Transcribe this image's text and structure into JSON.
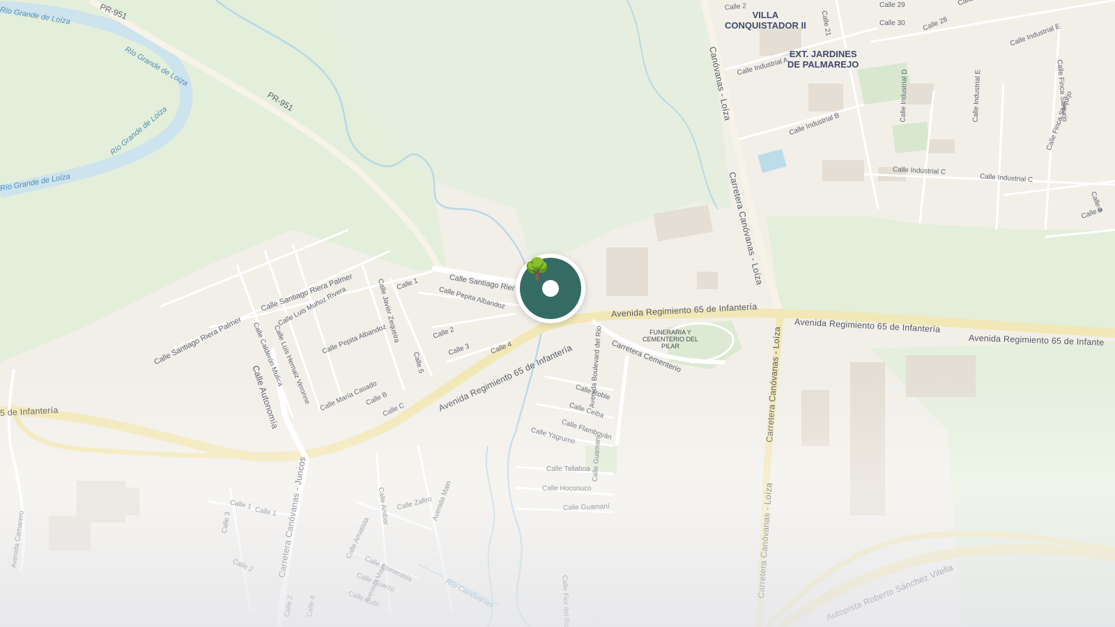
{
  "map": {
    "colors": {
      "land": "#f2efe9",
      "park": "#e3eedb",
      "water": "#cde3ee",
      "road": "#ffffff",
      "highway": "#f2e7b6",
      "building": "#e4ded4",
      "marker": "#356b65"
    },
    "marker": {
      "icon": "tree-icon",
      "color": "#356b65"
    },
    "labels": {
      "rio_grande_1": "Río Grande de Loíza",
      "rio_grande_2": "Río Grande de Loíza",
      "rio_grande_3": "Río Grande de Loíza",
      "rio_grande_4": "Río Grande de Loíza",
      "pr951_top": "PR-951",
      "pr951": "PR-951",
      "villa": "VILLA\nCONQUISTADOR II",
      "ext_jardines": "EXT. JARDINES\nDE PALMAREJO",
      "calle_2_top": "Calle 2",
      "calle_21": "Calle 21",
      "calle_29": "Calle 29",
      "calle_30": "Calle 30",
      "calle_28": "Calle 28",
      "calle_31": "Calle 31",
      "calle_industrial_e_1": "Calle Industrial E",
      "calle_industrial_a": "Calle Industrial A",
      "calle_industrial_b": "Calle Industrial B",
      "calle_industrial_c_1": "Calle Industrial C",
      "calle_industrial_c_2": "Calle Industrial C",
      "calle_industrial_d": "Calle Industrial D",
      "calle_industrial_e_2": "Calle Industrial E",
      "calle_finca": "Calle Finca Sanjurjo",
      "calle_finca_2": "Calle Finca Sanjurjo",
      "calle_9": "Calle 9",
      "calle_8": "Calle 8",
      "carretera_top": "Carretera Canóvanas - Loíza",
      "canovanas_loiza_top": "Canóvanas - Loíza",
      "avenida_1": "Avenida Regimiento 65 de Infantería",
      "avenida_2": "Avenida Regimiento 65 de Infantería",
      "avenida_3": "Avenida Regimiento 65 de Infante",
      "avenida_4": "Avenida Regimiento 65 de Infantería",
      "avenida_left": "5 de Infantería",
      "calle_santiago_1": "Calle Santiago Riera Palmer",
      "calle_santiago_2": "Calle Santiago Riera Palmer",
      "calle_santiago_3": "Calle Santiago Rier",
      "calle_luis_munoz": "Calle Luis Muñoz Rivera",
      "calle_pepita_1": "Calle Pepita Albandoz",
      "calle_pepita_2": "Calle Pepita Albandoz",
      "calle_javier": "Calle Javier Zequeira",
      "calle_1": "Calle 1",
      "calle_2": "Calle 2",
      "calle_3": "Calle 3",
      "calle_4": "Calle 4",
      "calle_5": "Calle 5",
      "calle_calderon": "Calle Calderón Mulica",
      "calle_luis_hernaiz": "Calle Luis Hernaiz Veronne",
      "calle_autonomia": "Calle Autonomía",
      "calle_maria": "Calle María Casado",
      "calle_b": "Calle B",
      "calle_c": "Calle C",
      "funeraria": "FUNERARIA Y\nCEMENTERIO DEL\nPILAR",
      "carretera_cementerio": "Carretera Cementerio",
      "calle_roble": "Calle Roble",
      "calle_ceiba": "Calle Ceiba",
      "calle_flamboyan": "Calle Flamboyán",
      "calle_yagrumo": "Calle Yagrumo",
      "avenida_boulevard": "Avenida Boulevard del Río",
      "calle_tallaboa": "Calle Tallaboa",
      "calle_hoconuco": "Calle Hoconuco",
      "calle_guamani_1": "Calle Guamaní",
      "calle_guamani_2": "Calle Guamaní",
      "calle_ambar": "Calle Ambar",
      "calle_zafiro": "Calle Zafiro",
      "avenida_main_1": "Avenida Main",
      "avenida_main_2": "Avenida Main",
      "calle_amatista": "Calle Amatista",
      "calle_esmeralda": "Calle Esmeralda",
      "calle_cuarzo": "Calle Cuarzo",
      "calle_rubi": "Calle Rubí",
      "calle_1b": "Calle 1",
      "calle_1c": "Calle 1",
      "calle_3b": "Calle 3",
      "calle_2b": "Calle 2",
      "calle_2c": "Calle 2",
      "calle_4b": "Calle 4",
      "avenida_camarero": "Avenida Camarero",
      "carretera_canovanas_juncos": "Carretera Canóvanas - Juncos",
      "carretera_canovanas_loiza_1": "Carretera Canóvanas - Loíza",
      "carretera_canovanas_loiza_2": "Carretera Canóvanas - Loíza",
      "calle_flor": "Calle Flor del Río",
      "rio_canovanas": "Río Canóvanas",
      "autopista": "Autopista Roberto Sánchez Vilella"
    }
  }
}
